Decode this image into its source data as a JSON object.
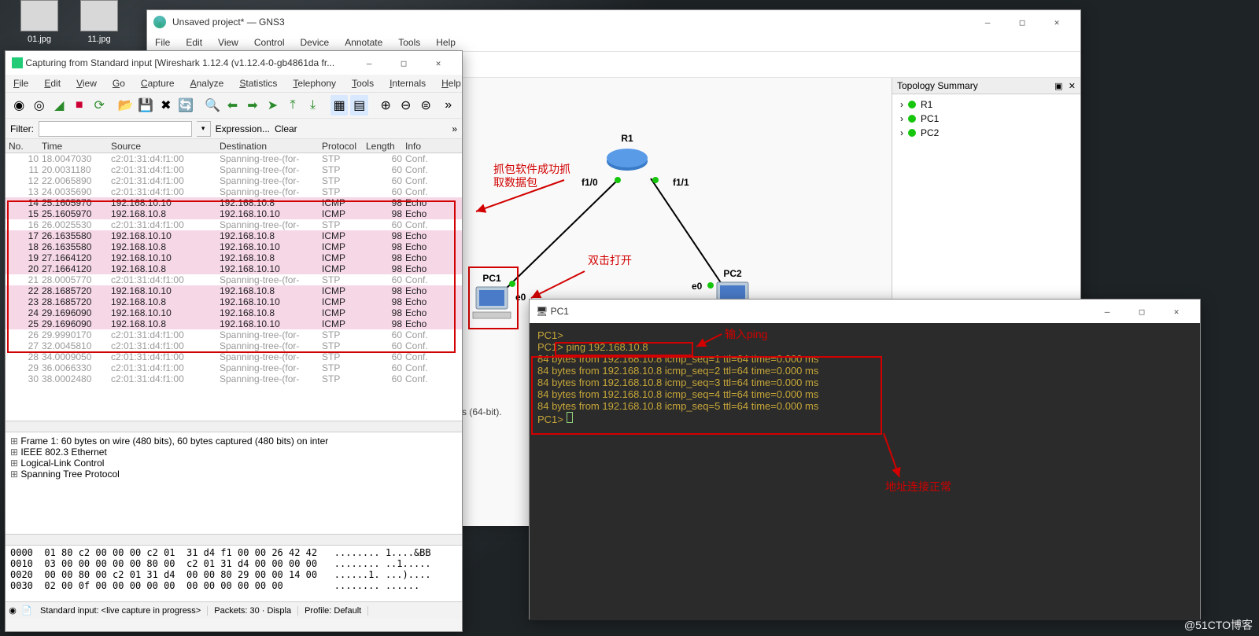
{
  "desktop": {
    "icons": [
      "01.jpg",
      "11.jpg"
    ],
    "watermark": "@51CTO博客"
  },
  "gns3": {
    "title": "Unsaved project* — GNS3",
    "menus": [
      "File",
      "Edit",
      "View",
      "Control",
      "Device",
      "Annotate",
      "Tools",
      "Help"
    ],
    "topology_title": "Topology Summary",
    "topology_items": [
      "R1",
      "PC1",
      "PC2"
    ],
    "nodes": {
      "r1": "R1",
      "pc1": "PC1",
      "pc2": "PC2",
      "f10": "f1/0",
      "f11": "f1/1",
      "e0a": "e0",
      "e0b": "e0"
    },
    "annot_capture": "抓包软件成功抓取数据包",
    "annot_dblclick": "双击打开",
    "status_fragment": "s (64-bit)."
  },
  "wireshark": {
    "title": "Capturing from Standard input   [Wireshark 1.12.4  (v1.12.4-0-gb4861da fr...",
    "menus": [
      "File",
      "Edit",
      "View",
      "Go",
      "Capture",
      "Analyze",
      "Statistics",
      "Telephony",
      "Tools",
      "Internals",
      "Help"
    ],
    "filter_label": "Filter:",
    "filter_value": "",
    "expr_label": "Expression...",
    "clear_label": "Clear",
    "columns": [
      "No.",
      "Time",
      "Source",
      "Destination",
      "Protocol",
      "Length",
      "Info"
    ],
    "packets": [
      {
        "no": "10",
        "time": "18.0047030",
        "src": "c2:01:31:d4:f1:00",
        "dst": "Spanning-tree-(for-",
        "proto": "STP",
        "len": "60",
        "info": "Conf.",
        "cls": "stp"
      },
      {
        "no": "11",
        "time": "20.0031180",
        "src": "c2:01:31:d4:f1:00",
        "dst": "Spanning-tree-(for-",
        "proto": "STP",
        "len": "60",
        "info": "Conf.",
        "cls": "stp"
      },
      {
        "no": "12",
        "time": "22.0065890",
        "src": "c2:01:31:d4:f1:00",
        "dst": "Spanning-tree-(for-",
        "proto": "STP",
        "len": "60",
        "info": "Conf.",
        "cls": "stp"
      },
      {
        "no": "13",
        "time": "24.0035690",
        "src": "c2:01:31:d4:f1:00",
        "dst": "Spanning-tree-(for-",
        "proto": "STP",
        "len": "60",
        "info": "Conf.",
        "cls": "stp"
      },
      {
        "no": "14",
        "time": "25.1605970",
        "src": "192.168.10.10",
        "dst": "192.168.10.8",
        "proto": "ICMP",
        "len": "98",
        "info": "Echo",
        "cls": "icmp"
      },
      {
        "no": "15",
        "time": "25.1605970",
        "src": "192.168.10.8",
        "dst": "192.168.10.10",
        "proto": "ICMP",
        "len": "98",
        "info": "Echo",
        "cls": "icmp"
      },
      {
        "no": "16",
        "time": "26.0025530",
        "src": "c2:01:31:d4:f1:00",
        "dst": "Spanning-tree-(for-",
        "proto": "STP",
        "len": "60",
        "info": "Conf.",
        "cls": "stp"
      },
      {
        "no": "17",
        "time": "26.1635580",
        "src": "192.168.10.10",
        "dst": "192.168.10.8",
        "proto": "ICMP",
        "len": "98",
        "info": "Echo",
        "cls": "icmp"
      },
      {
        "no": "18",
        "time": "26.1635580",
        "src": "192.168.10.8",
        "dst": "192.168.10.10",
        "proto": "ICMP",
        "len": "98",
        "info": "Echo",
        "cls": "icmp"
      },
      {
        "no": "19",
        "time": "27.1664120",
        "src": "192.168.10.10",
        "dst": "192.168.10.8",
        "proto": "ICMP",
        "len": "98",
        "info": "Echo",
        "cls": "icmp"
      },
      {
        "no": "20",
        "time": "27.1664120",
        "src": "192.168.10.8",
        "dst": "192.168.10.10",
        "proto": "ICMP",
        "len": "98",
        "info": "Echo",
        "cls": "icmp"
      },
      {
        "no": "21",
        "time": "28.0005770",
        "src": "c2:01:31:d4:f1:00",
        "dst": "Spanning-tree-(for-",
        "proto": "STP",
        "len": "60",
        "info": "Conf.",
        "cls": "stp"
      },
      {
        "no": "22",
        "time": "28.1685720",
        "src": "192.168.10.10",
        "dst": "192.168.10.8",
        "proto": "ICMP",
        "len": "98",
        "info": "Echo",
        "cls": "icmp"
      },
      {
        "no": "23",
        "time": "28.1685720",
        "src": "192.168.10.8",
        "dst": "192.168.10.10",
        "proto": "ICMP",
        "len": "98",
        "info": "Echo",
        "cls": "icmp"
      },
      {
        "no": "24",
        "time": "29.1696090",
        "src": "192.168.10.10",
        "dst": "192.168.10.8",
        "proto": "ICMP",
        "len": "98",
        "info": "Echo",
        "cls": "icmp"
      },
      {
        "no": "25",
        "time": "29.1696090",
        "src": "192.168.10.8",
        "dst": "192.168.10.10",
        "proto": "ICMP",
        "len": "98",
        "info": "Echo",
        "cls": "icmp"
      },
      {
        "no": "26",
        "time": "29.9990170",
        "src": "c2:01:31:d4:f1:00",
        "dst": "Spanning-tree-(for-",
        "proto": "STP",
        "len": "60",
        "info": "Conf.",
        "cls": "stp"
      },
      {
        "no": "27",
        "time": "32.0045810",
        "src": "c2:01:31:d4:f1:00",
        "dst": "Spanning-tree-(for-",
        "proto": "STP",
        "len": "60",
        "info": "Conf.",
        "cls": "stp"
      },
      {
        "no": "28",
        "time": "34.0009050",
        "src": "c2:01:31:d4:f1:00",
        "dst": "Spanning-tree-(for-",
        "proto": "STP",
        "len": "60",
        "info": "Conf.",
        "cls": "stp"
      },
      {
        "no": "29",
        "time": "36.0066330",
        "src": "c2:01:31:d4:f1:00",
        "dst": "Spanning-tree-(for-",
        "proto": "STP",
        "len": "60",
        "info": "Conf.",
        "cls": "stp"
      },
      {
        "no": "30",
        "time": "38.0002480",
        "src": "c2:01:31:d4:f1:00",
        "dst": "Spanning-tree-(for-",
        "proto": "STP",
        "len": "60",
        "info": "Conf.",
        "cls": "stp"
      }
    ],
    "details": [
      "Frame 1: 60 bytes on wire (480 bits), 60 bytes captured (480 bits) on inter",
      "IEEE 802.3 Ethernet",
      "Logical-Link Control",
      "Spanning Tree Protocol"
    ],
    "hex": "0000  01 80 c2 00 00 00 c2 01  31 d4 f1 00 00 26 42 42   ........ 1....&BB\n0010  03 00 00 00 00 00 80 00  c2 01 31 d4 00 00 00 00   ........ ..1.....\n0020  00 00 80 00 c2 01 31 d4  00 00 80 29 00 00 14 00   ......1. ...)....\n0030  02 00 0f 00 00 00 00 00  00 00 00 00 00 00         ........ ......",
    "status": {
      "s1": "Standard input: <live capture in progress>",
      "s2": "Packets: 30 · Displa",
      "s3": "Profile: Default"
    }
  },
  "terminal": {
    "title": "PC1",
    "lines": [
      "PC1>",
      "PC1> ping 192.168.10.8",
      "84 bytes from 192.168.10.8 icmp_seq=1 ttl=64 time=0.000 ms",
      "84 bytes from 192.168.10.8 icmp_seq=2 ttl=64 time=0.000 ms",
      "84 bytes from 192.168.10.8 icmp_seq=3 ttl=64 time=0.000 ms",
      "84 bytes from 192.168.10.8 icmp_seq=4 ttl=64 time=0.000 ms",
      "84 bytes from 192.168.10.8 icmp_seq=5 ttl=64 time=0.000 ms",
      "",
      "PC1> "
    ],
    "annot_ping": "输入ping",
    "annot_ok": "地址连接正常"
  }
}
